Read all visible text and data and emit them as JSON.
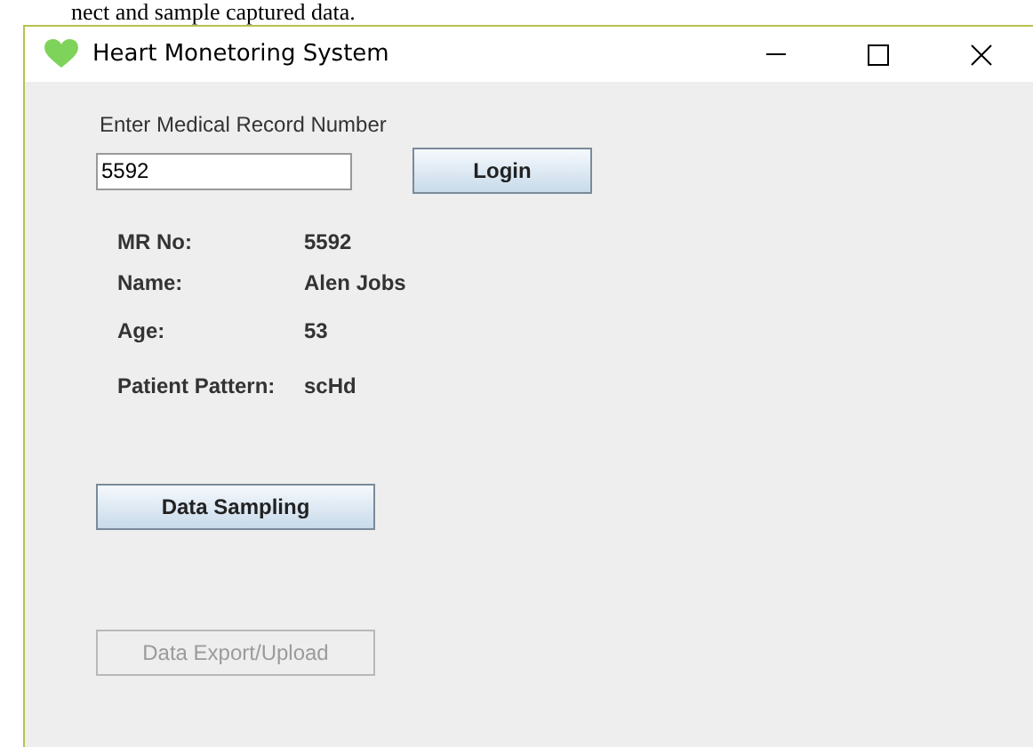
{
  "document_text": "nect and sample captured data.",
  "window": {
    "title": "Heart Monetoring System",
    "controls": [
      {
        "kind": "minimize"
      },
      {
        "kind": "maximize"
      },
      {
        "kind": "close"
      }
    ]
  },
  "record_prompt": "Enter Medical Record Number",
  "record_field": {
    "value": "5592"
  },
  "login_button": {
    "label": "Login",
    "disabled": false
  },
  "patient_info": [
    {
      "label": "MR No:",
      "value": "5592"
    },
    {
      "label": "Name:",
      "value": "Alen Jobs"
    },
    {
      "label": "Age:",
      "value": "53"
    },
    {
      "label": "Patient Pattern:",
      "value": "scHd"
    }
  ],
  "actions": [
    {
      "label": "Data Sampling",
      "disabled": false
    },
    {
      "label": "Data Export/Upload",
      "disabled": true
    }
  ]
}
